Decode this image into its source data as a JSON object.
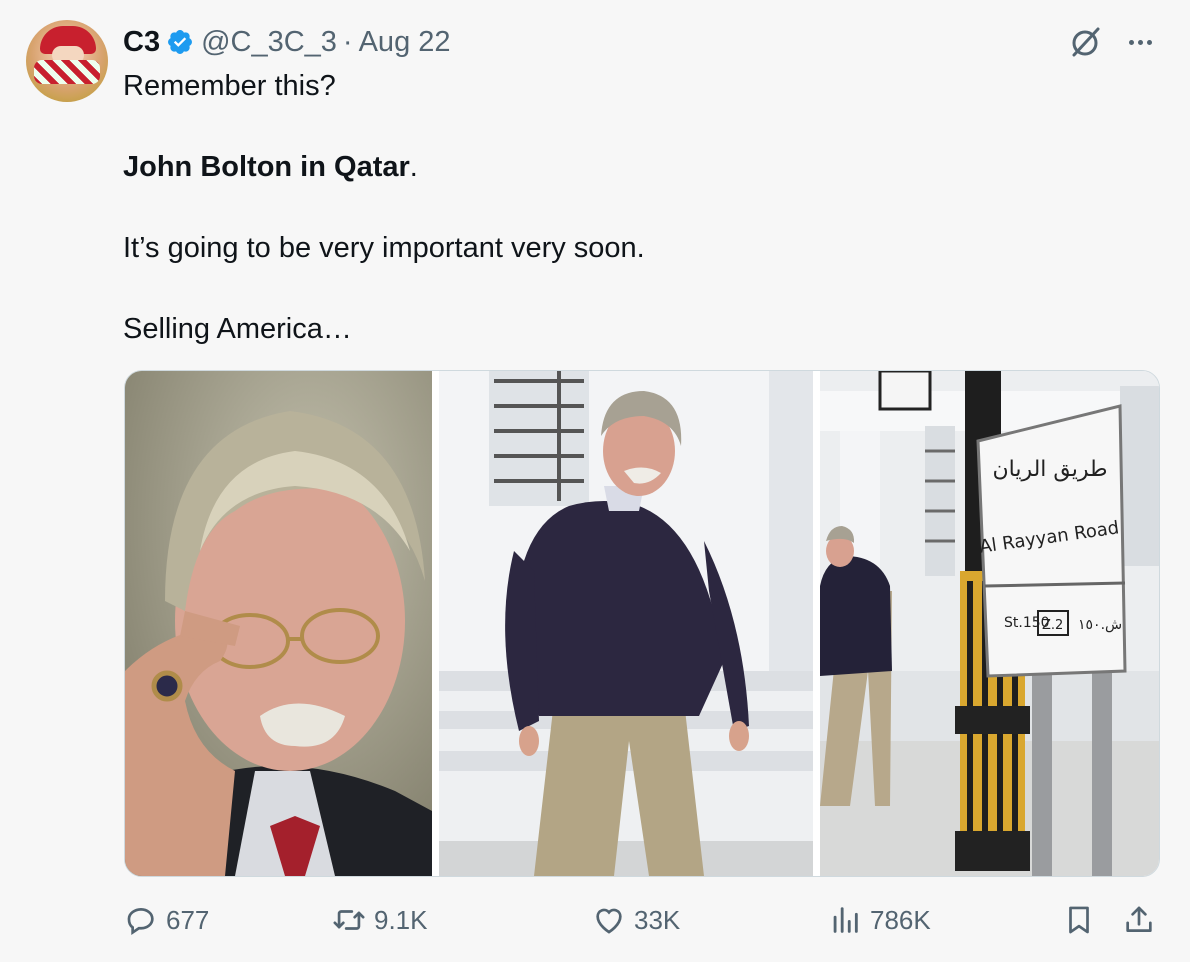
{
  "author": {
    "name": "C3",
    "handle": "@C_3C_3",
    "separator": "·",
    "date": "Aug 22"
  },
  "tweet": {
    "line1": "Remember this?",
    "bold_text": "John Bolton in Qatar",
    "bold_suffix": ".",
    "line3": "It’s going to be very important very soon.",
    "line4": "Selling America…"
  },
  "media": {
    "sign_arabic": "طريق الريان",
    "sign_english": "Al Rayyan Road",
    "sign_street": "St.150",
    "sign_zone": "Z.2",
    "sign_arabic_num": "ش.١٥٠"
  },
  "actions": {
    "replies": "677",
    "reposts": "9.1K",
    "likes": "33K",
    "views": "786K"
  },
  "icons": {
    "verified": "verified-badge-icon",
    "grok": "grok-icon",
    "more": "more-icon",
    "reply": "reply-icon",
    "repost": "repost-icon",
    "like": "like-icon",
    "views": "views-icon",
    "bookmark": "bookmark-icon",
    "share": "share-icon"
  },
  "colors": {
    "verified": "#1d9bf0",
    "secondary_text": "#536471",
    "primary_text": "#0f1419",
    "background": "#f7f7f7"
  }
}
